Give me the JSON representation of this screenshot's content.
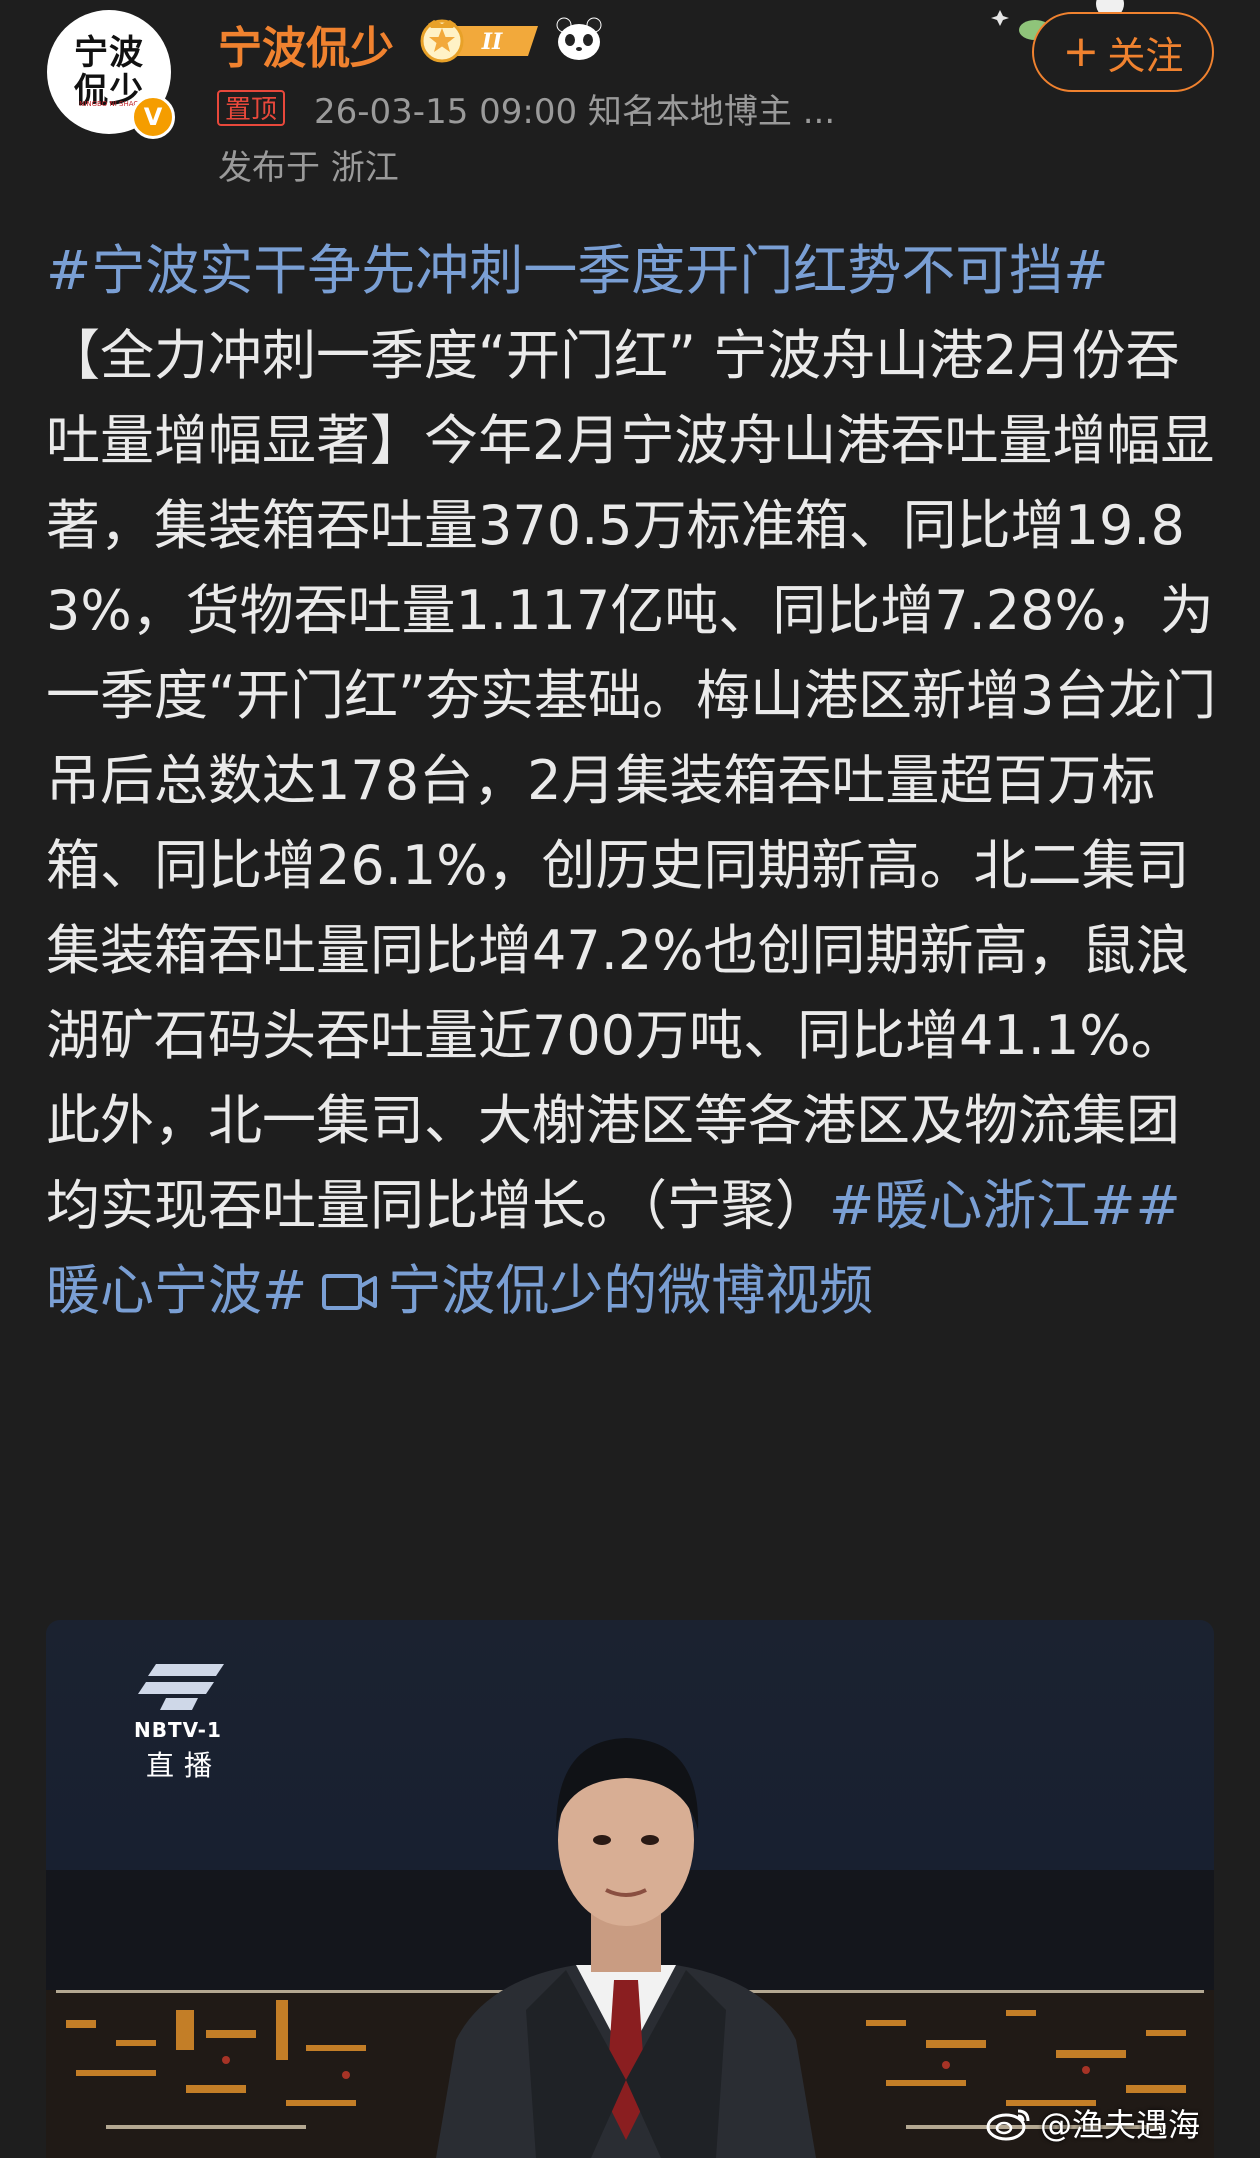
{
  "author": {
    "avatar_text": "宁波\n侃少",
    "avatar_sub": "NINGBO NI SHAO",
    "verified_mark": "V",
    "name": "宁波侃少",
    "vip_level": "II"
  },
  "post_meta": {
    "pinned_label": "置顶",
    "timestamp_and_role": "26-03-15 09:00  知名本地博主 ...",
    "location": "发布于 浙江"
  },
  "follow_button": {
    "label": "关注",
    "icon": "plus-icon"
  },
  "post": {
    "topic_1": "#宁波实干争先冲刺一季度开门红势不可挡#",
    "body": " 【全力冲刺一季度“开门红” 宁波舟山港2月份吞吐量增幅显著】今年2月宁波舟山港吞吐量增幅显著，集装箱吞吐量370.5万标准箱、同比增19.83%，货物吞吐量1.117亿吨、同比增7.28%，为一季度“开门红”夯实基础。梅山港区新增3台龙门吊后总数达178台，2月集装箱吞吐量超百万标箱、同比增26.1%，创历史同期新高。北二集司集装箱吞吐量同比增47.2%也创同期新高，鼠浪湖矿石码头吞吐量近700万吨、同比增41.1%。此外，北一集司、大榭港区等各港区及物流集团均实现吞吐量同比增长。（宁聚）",
    "topic_2": "#暖心浙江#",
    "topic_3": "#暖心宁波#",
    "video_link_label": "宁波侃少的微博视频"
  },
  "video": {
    "channel": "NBTV-1",
    "live_label": "直播",
    "watermark": "@渔夫遇海"
  },
  "colors": {
    "background": "#1e1e1e",
    "accent_orange": "#f0822f",
    "topic_blue": "#7a9fd4",
    "pin_red": "#e8483b"
  }
}
